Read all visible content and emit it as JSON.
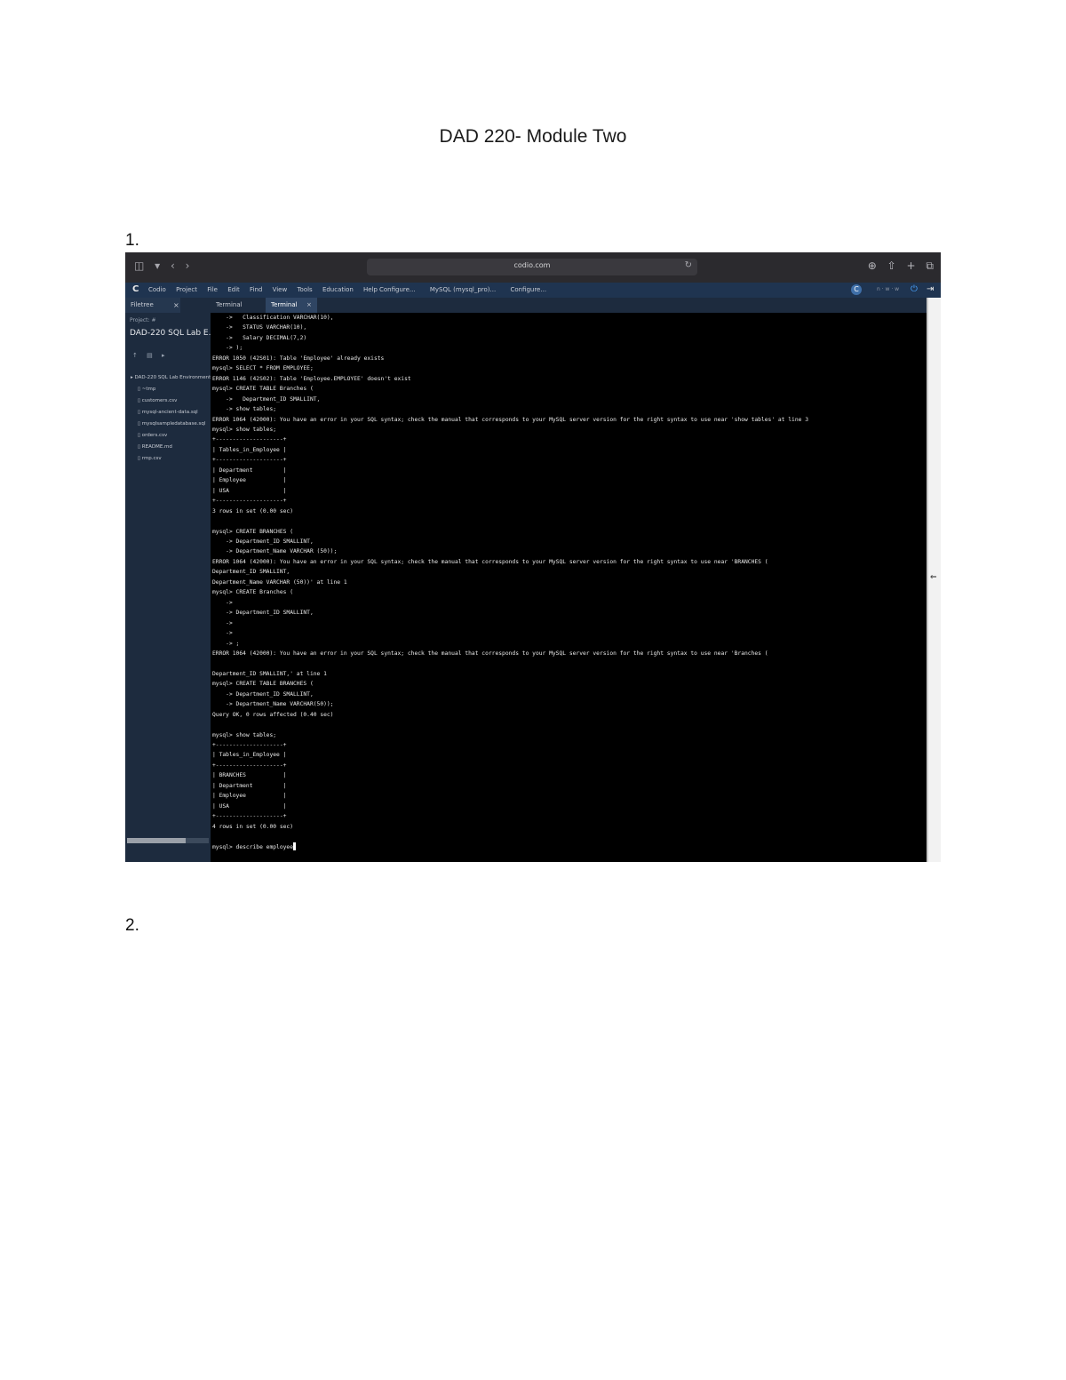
{
  "document": {
    "title": "DAD 220- Module Two",
    "items": [
      "1.",
      "2."
    ]
  },
  "browser": {
    "url": "codio.com",
    "left_icons": [
      "◫",
      "▾",
      "‹",
      "›"
    ],
    "right_icons": [
      "⊕",
      "⇧",
      "+",
      "⧉"
    ]
  },
  "ide": {
    "menu": [
      "Codio",
      "Project",
      "File",
      "Edit",
      "Find",
      "View",
      "Tools",
      "Education",
      "Help"
    ],
    "tabs": [
      "Configure...",
      "MySQL (mysql_pro)...",
      "Configure..."
    ],
    "user_initial": "C",
    "right_text": "n · w · w",
    "side_tab": "Filetree",
    "project_label": "Project: #",
    "project_name": "DAD-220 SQL Lab E...",
    "tree_controls": [
      "↑",
      "▤",
      "▸"
    ],
    "files": [
      {
        "name": "DAD-220 SQL Lab Environment",
        "child": false
      },
      {
        "name": "~tmp",
        "child": true
      },
      {
        "name": "customers.csv",
        "child": true
      },
      {
        "name": "mysql-ancient-data.sql",
        "child": true
      },
      {
        "name": "mysqlsampledatabase.sql",
        "child": true
      },
      {
        "name": "orders.csv",
        "child": true
      },
      {
        "name": "README.md",
        "child": true
      },
      {
        "name": "rmp.csv",
        "child": true
      }
    ],
    "terminal_tabs": [
      "Terminal",
      "Terminal"
    ]
  },
  "terminal": {
    "lines": [
      "    ->   Classification VARCHAR(10),",
      "    ->   STATUS VARCHAR(10),",
      "    ->   Salary DECIMAL(7,2)",
      "    -> );",
      "ERROR 1050 (42S01): Table 'Employee' already exists",
      "mysql> SELECT * FROM EMPLOYEE;",
      "ERROR 1146 (42S02): Table 'Employee.EMPLOYEE' doesn't exist",
      "mysql> CREATE TABLE Branches (",
      "    ->   Department_ID SMALLINT,",
      "    -> show tables;",
      "ERROR 1064 (42000): You have an error in your SQL syntax; check the manual that corresponds to your MySQL server version for the right syntax to use near 'show tables' at line 3",
      "mysql> show tables;",
      "+--------------------+",
      "| Tables_in_Employee |",
      "+--------------------+",
      "| Department         |",
      "| Employee           |",
      "| USA                |",
      "+--------------------+",
      "3 rows in set (0.00 sec)",
      "",
      "mysql> CREATE BRANCHES (",
      "    -> Department_ID SMALLINT,",
      "    -> Department_Name VARCHAR (50));",
      "ERROR 1064 (42000): You have an error in your SQL syntax; check the manual that corresponds to your MySQL server version for the right syntax to use near 'BRANCHES (",
      "Department_ID SMALLINT,",
      "Department_Name VARCHAR (50))' at line 1",
      "mysql> CREATE Branches (",
      "    ->",
      "    -> Department_ID SMALLINT,",
      "    ->",
      "    ->",
      "    -> ;",
      "ERROR 1064 (42000): You have an error in your SQL syntax; check the manual that corresponds to your MySQL server version for the right syntax to use near 'Branches (",
      "",
      "Department_ID SMALLINT,' at line 1",
      "mysql> CREATE TABLE BRANCHES (",
      "    -> Department_ID SMALLINT,",
      "    -> Department_Name VARCHAR(50));",
      "Query OK, 0 rows affected (0.40 sec)",
      "",
      "mysql> show tables;",
      "+--------------------+",
      "| Tables_in_Employee |",
      "+--------------------+",
      "| BRANCHES           |",
      "| Department         |",
      "| Employee           |",
      "| USA                |",
      "+--------------------+",
      "4 rows in set (0.00 sec)",
      "",
      "mysql> describe employee"
    ]
  }
}
